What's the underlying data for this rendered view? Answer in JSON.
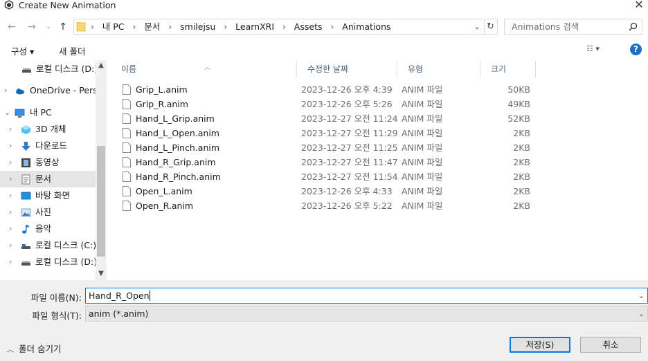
{
  "window": {
    "title": "Create New Animation",
    "close_label": "✕"
  },
  "nav": {
    "breadcrumb": [
      "내 PC",
      "문서",
      "smilejsu",
      "LearnXRI",
      "Assets",
      "Animations"
    ],
    "search_placeholder": "Animations 검색"
  },
  "toolbar": {
    "organize_label": "구성 ▾",
    "new_folder_label": "새 폴더"
  },
  "sidebar": {
    "items": [
      {
        "label": "로컬 디스크 (D:)",
        "icon": "drive-icon"
      },
      {
        "label": "OneDrive - Personal",
        "icon": "onedrive-icon"
      },
      {
        "label": "내 PC",
        "icon": "pc-icon"
      },
      {
        "label": "3D 개체",
        "icon": "3d-objects-icon"
      },
      {
        "label": "다운로드",
        "icon": "download-icon"
      },
      {
        "label": "동영상",
        "icon": "video-icon"
      },
      {
        "label": "문서",
        "icon": "documents-icon"
      },
      {
        "label": "바탕 화면",
        "icon": "desktop-icon"
      },
      {
        "label": "사진",
        "icon": "pictures-icon"
      },
      {
        "label": "음악",
        "icon": "music-icon"
      },
      {
        "label": "로컬 디스크 (C:)",
        "icon": "drive-icon"
      },
      {
        "label": "로컬 디스크 (D:)",
        "icon": "drive-icon"
      }
    ],
    "selected": "문서"
  },
  "columns": {
    "name": "이름",
    "date": "수정한 날짜",
    "type": "유형",
    "size": "크기"
  },
  "files": [
    {
      "name": "Grip_L.anim",
      "date": "2023-12-26 오후 4:39",
      "type": "ANIM 파일",
      "size": "50KB"
    },
    {
      "name": "Grip_R.anim",
      "date": "2023-12-26 오후 5:26",
      "type": "ANIM 파일",
      "size": "49KB"
    },
    {
      "name": "Hand_L_Grip.anim",
      "date": "2023-12-27 오전 11:24",
      "type": "ANIM 파일",
      "size": "52KB"
    },
    {
      "name": "Hand_L_Open.anim",
      "date": "2023-12-27 오전 11:29",
      "type": "ANIM 파일",
      "size": "2KB"
    },
    {
      "name": "Hand_L_Pinch.anim",
      "date": "2023-12-27 오전 11:25",
      "type": "ANIM 파일",
      "size": "2KB"
    },
    {
      "name": "Hand_R_Grip.anim",
      "date": "2023-12-27 오전 11:47",
      "type": "ANIM 파일",
      "size": "2KB"
    },
    {
      "name": "Hand_R_Pinch.anim",
      "date": "2023-12-27 오전 11:54",
      "type": "ANIM 파일",
      "size": "2KB"
    },
    {
      "name": "Open_L.anim",
      "date": "2023-12-26 오후 4:33",
      "type": "ANIM 파일",
      "size": "2KB"
    },
    {
      "name": "Open_R.anim",
      "date": "2023-12-26 오후 5:22",
      "type": "ANIM 파일",
      "size": "2KB"
    }
  ],
  "footer": {
    "filename_label": "파일 이름(N):",
    "filename_value": "Hand_R_Open",
    "filetype_label": "파일 형식(T):",
    "filetype_value": "anim (*.anim)",
    "hide_folders_label": "폴더 숨기기",
    "save_label": "저장(S)",
    "cancel_label": "취소"
  },
  "colors": {
    "accent": "#0078d7",
    "selected_bg": "#e5e5e5",
    "panel_bg": "#f0f0f0"
  }
}
